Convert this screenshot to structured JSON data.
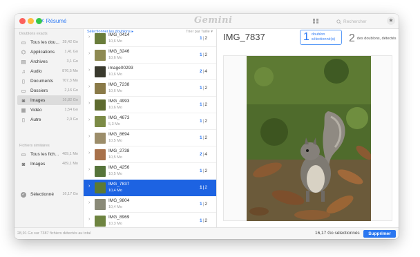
{
  "titlebar": {
    "back_label": "Résumé",
    "logo": "Gemini",
    "search_placeholder": "Rechercher"
  },
  "sidebar": {
    "duplicates_title": "Doublons exacts",
    "items": [
      {
        "label": "Tous les dou...",
        "size": "28,42 Go",
        "icon": "folder-icon"
      },
      {
        "label": "Applications",
        "size": "1,41 Go",
        "icon": "applications-icon"
      },
      {
        "label": "Archives",
        "size": "3,1 Go",
        "icon": "archive-icon"
      },
      {
        "label": "Audio",
        "size": "876,5 Mo",
        "icon": "music-icon"
      },
      {
        "label": "Documents",
        "size": "707,3 Mo",
        "icon": "document-icon"
      },
      {
        "label": "Dossiers",
        "size": "2,16 Go",
        "icon": "folder-icon"
      },
      {
        "label": "Images",
        "size": "16,82 Go",
        "icon": "camera-icon"
      },
      {
        "label": "Vidéo",
        "size": "1,54 Go",
        "icon": "video-icon"
      },
      {
        "label": "Autre",
        "size": "2,9 Go",
        "icon": "file-icon"
      }
    ],
    "similar_title": "Fichiers similaires",
    "similar_items": [
      {
        "label": "Tous les fich...",
        "size": "489,1 Mo",
        "icon": "folder-icon"
      },
      {
        "label": "Images",
        "size": "489,1 Mo",
        "icon": "camera-icon"
      }
    ],
    "selected": {
      "label": "Sélectionné",
      "size": "16,17 Go",
      "icon": "check-circle-icon"
    }
  },
  "list": {
    "select_label": "Sélectionner les doublons ▸",
    "sort_label": "Trier par Taille ▾",
    "rows": [
      {
        "name": "IMG_0414",
        "size": "10,6 Mo",
        "selected": "1",
        "total": "2",
        "thumb": "#6a7d3b"
      },
      {
        "name": "IMG_3246",
        "size": "10,6 Mo",
        "selected": "1",
        "total": "2",
        "thumb": "#8e8a52"
      },
      {
        "name": "image00293",
        "size": "10,6 Mo",
        "selected": "2",
        "total": "4",
        "thumb": "#3a3a2e"
      },
      {
        "name": "IMG_7238",
        "size": "10,6 Mo",
        "selected": "1",
        "total": "2",
        "thumb": "#8a7a48"
      },
      {
        "name": "IMG_4993",
        "size": "10,6 Mo",
        "selected": "1",
        "total": "2",
        "thumb": "#5e6b2f"
      },
      {
        "name": "IMG_4673",
        "size": "5,3 Mo",
        "selected": "1",
        "total": "2",
        "thumb": "#7c8b46"
      },
      {
        "name": "IMG_8694",
        "size": "10,5 Mo",
        "selected": "1",
        "total": "2",
        "thumb": "#9c8d6a"
      },
      {
        "name": "IMG_2738",
        "size": "10,5 Mo",
        "selected": "2",
        "total": "4",
        "thumb": "#a8714a"
      },
      {
        "name": "IMG_4256",
        "size": "10,5 Mo",
        "selected": "1",
        "total": "2",
        "thumb": "#56743a"
      },
      {
        "name": "IMG_7837",
        "size": "10,4 Mo",
        "selected": "1",
        "total": "2",
        "thumb": "#5d7a33",
        "is_selected": true
      },
      {
        "name": "IMG_9804",
        "size": "10,4 Mo",
        "selected": "1",
        "total": "2",
        "thumb": "#8a8a78"
      },
      {
        "name": "IMG_8969",
        "size": "10,3 Mo",
        "selected": "1",
        "total": "2",
        "thumb": "#6e8440"
      }
    ]
  },
  "preview": {
    "title": "IMG_7837",
    "selected_count": "1",
    "selected_label": "doublon sélectionné(s)",
    "detected_count": "2",
    "detected_label": "des doublons, détectés"
  },
  "footer": {
    "summary": "28,91 Go sur 7387 fichiers détectés au total",
    "selected_total": "16,17 Go sélectionnés",
    "delete_label": "Supprimer"
  },
  "colors": {
    "accent": "#2f7bf5",
    "selection": "#1d63e2",
    "delete_button": "#2a77f0"
  }
}
